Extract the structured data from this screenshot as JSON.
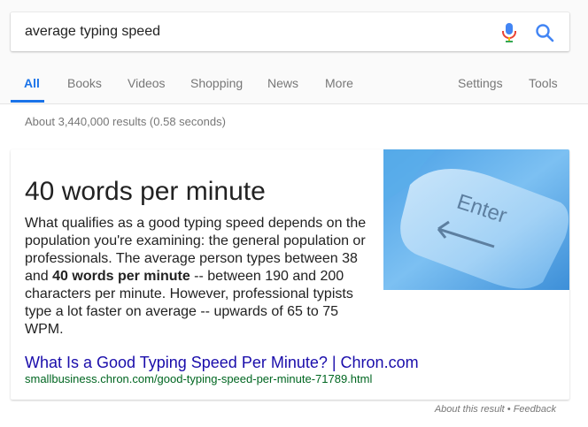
{
  "search": {
    "query": "average typing speed"
  },
  "tabs": [
    {
      "label": "All",
      "active": true
    },
    {
      "label": "Books"
    },
    {
      "label": "Videos"
    },
    {
      "label": "Shopping"
    },
    {
      "label": "News"
    },
    {
      "label": "More"
    },
    {
      "label": "Settings"
    },
    {
      "label": "Tools"
    }
  ],
  "results_stats": "About 3,440,000 results (0.58 seconds)",
  "featured_snippet": {
    "answer": "40 words per minute",
    "snippet_before": "What qualifies as a good typing speed depends on the population you're examining: the general population or professionals. The average person types between 38 and ",
    "snippet_bold": "40 words per minute",
    "snippet_after": " -- between 190 and 200 characters per minute. However, professional typists type a lot faster on average -- upwards of 65 to 75 WPM.",
    "image_text": "Enter",
    "link_title": "What Is a Good Typing Speed Per Minute? | Chron.com",
    "link_url": "smallbusiness.chron.com/good-typing-speed-per-minute-71789.html"
  },
  "footer": {
    "about": "About this result",
    "separator": " • ",
    "feedback": "Feedback"
  },
  "colors": {
    "accent": "#1a73e8",
    "link": "#1a0dab",
    "url": "#006621"
  }
}
